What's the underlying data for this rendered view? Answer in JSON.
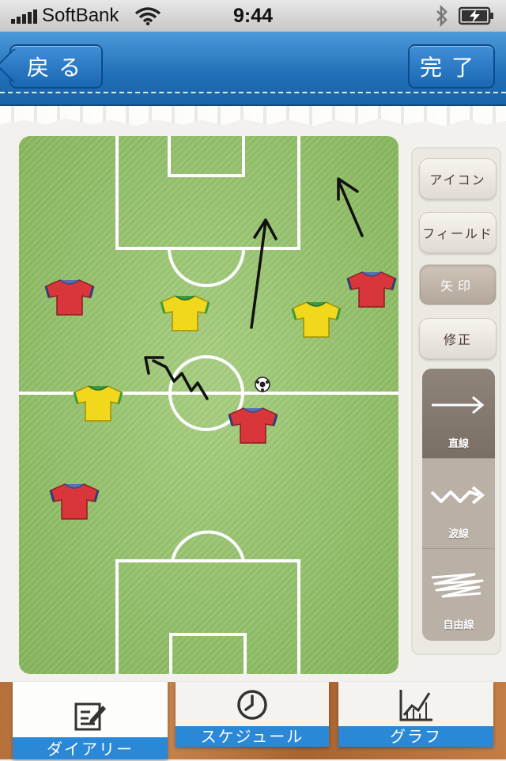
{
  "status_bar": {
    "carrier": "SoftBank",
    "time": "9:44"
  },
  "nav": {
    "back_label": "戻る",
    "done_label": "完了"
  },
  "side_menu": {
    "items": [
      {
        "label": "アイコン"
      },
      {
        "label": "フィールド"
      },
      {
        "label": "矢印",
        "active": true
      },
      {
        "label": "修正"
      }
    ],
    "line_types": [
      {
        "label": "直線",
        "selected": true
      },
      {
        "label": "波線",
        "selected": false
      },
      {
        "label": "自由線",
        "selected": false
      }
    ]
  },
  "tabs": [
    {
      "label": "ダイアリー",
      "icon": "edit-icon",
      "selected": true
    },
    {
      "label": "スケジュール",
      "icon": "clock-icon",
      "selected": false
    },
    {
      "label": "グラフ",
      "icon": "chart-icon",
      "selected": false
    }
  ],
  "colors": {
    "nav_blue": "#1f6fb8",
    "tab_blue": "#2a88d6",
    "pitch_green": "#8fbd66",
    "red_team": "#d9363b",
    "yellow_team": "#f2d81c"
  }
}
